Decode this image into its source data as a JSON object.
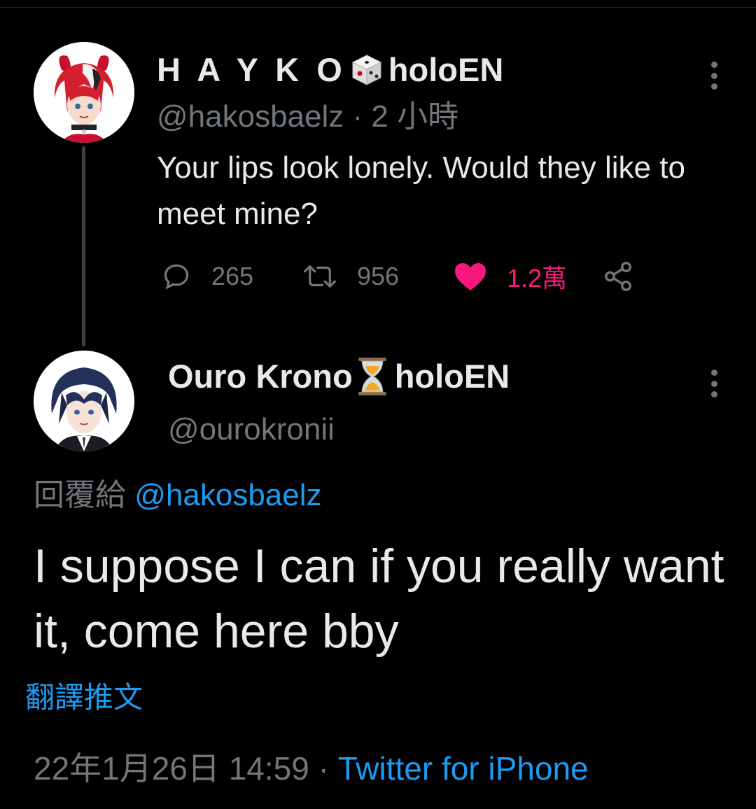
{
  "tweet1": {
    "name": "H A Y K O",
    "name_suffix": "holoEN",
    "name_emoji": "dice-emoji",
    "handle": "@hakosbaelz",
    "separator": " · ",
    "time": "2 小時",
    "text": "Your lips look lonely. Would they like to meet mine?",
    "actions": {
      "reply_icon": "reply-icon",
      "reply_count": "265",
      "retweet_icon": "retweet-icon",
      "retweet_count": "956",
      "like_icon": "heart-filled-icon",
      "like_count": "1.2萬",
      "share_icon": "share-icon"
    },
    "like_color": "#f91880"
  },
  "tweet2": {
    "name": "Ouro Krono",
    "name_suffix": "holoEN",
    "name_emoji": "hourglass-emoji",
    "handle": "@ourokronii",
    "reply_prefix": "回覆給 ",
    "reply_mention": "@hakosbaelz",
    "text": "I suppose I can if you really want it, come here bby",
    "translate_label": "翻譯推文",
    "date": "22年1月26日 14:59",
    "separator": " · ",
    "source": "Twitter for iPhone"
  },
  "colors": {
    "background": "#000000",
    "text": "#e7e9ea",
    "muted": "#71767b",
    "link": "#1d9bf0"
  }
}
